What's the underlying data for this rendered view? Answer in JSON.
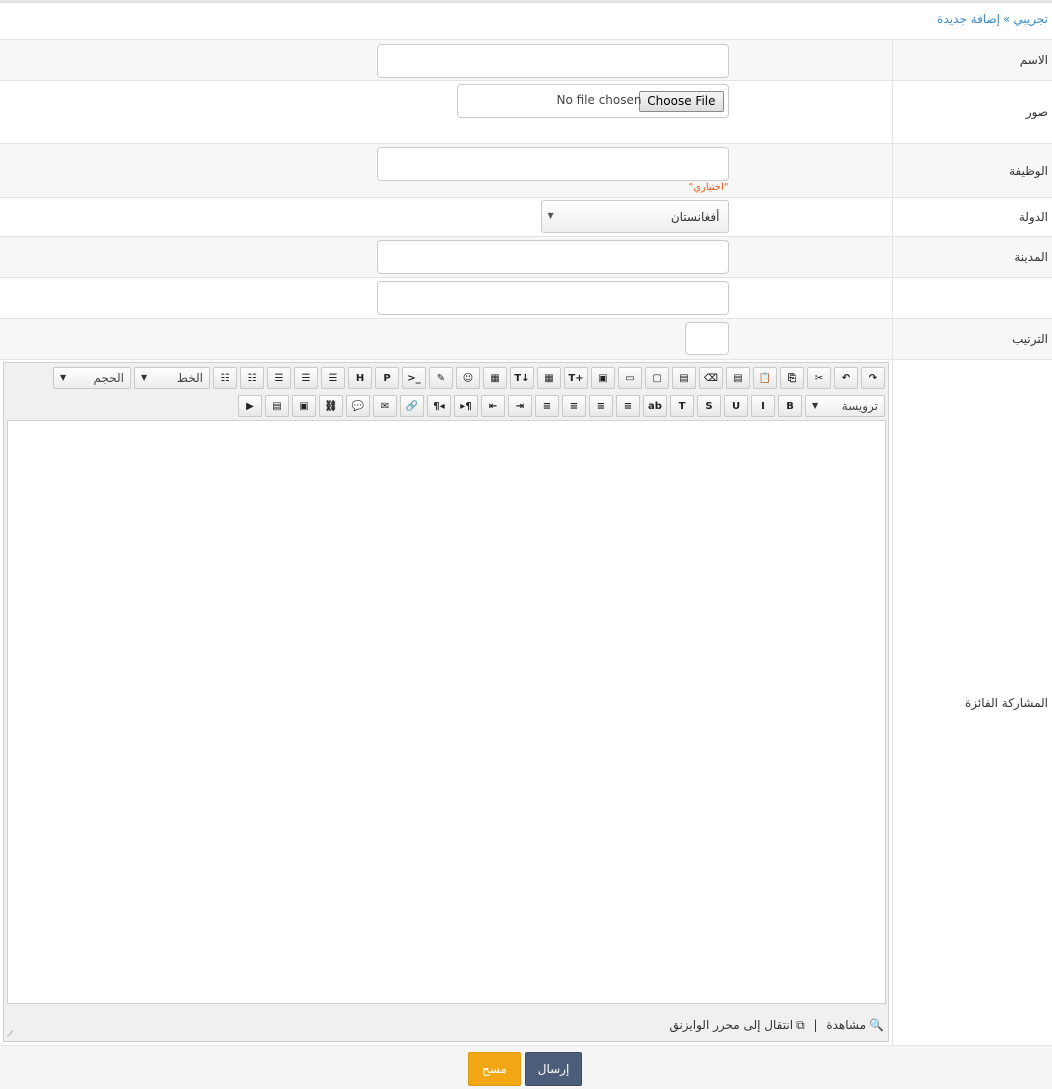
{
  "breadcrumb": {
    "parent": "تجريبي",
    "separator": "»",
    "current": "إضافة جديدة"
  },
  "form": {
    "name_label": "الاسم",
    "photos_label": "صور",
    "file_button": "Choose File",
    "file_status": "No file chosen",
    "job_label": "الوظيفة",
    "job_hint": "\"اختياري\"",
    "country_label": "الدولة",
    "country_value": "أفغانستان",
    "city_label": "المدينة",
    "extra_label": "",
    "order_label": "الترتيب",
    "entry_label": "المشاركة الفائزة"
  },
  "editor": {
    "format_select": "ترويسة",
    "font_select": "الخط",
    "size_select": "الحجم",
    "preview_label": "مشاهدة",
    "foot_sep": "|",
    "wysiwyg_label": "انتقال إلى محرر الوايزنق",
    "row1_icons": [
      "redo-icon",
      "undo-icon",
      "cut-icon",
      "copy-icon",
      "paste-icon",
      "paste-text-icon",
      "eraser-icon",
      "paste-word-icon",
      "fullscreen-icon",
      "image-icon",
      "insert-image-icon",
      "insert-text-icon",
      "insert-file-icon",
      "insert-text-below-icon",
      "insert-file-below-icon",
      "emoticon-icon",
      "edit-icon",
      "code-icon",
      "php-icon",
      "html-icon",
      "ordered-list-icon",
      "unordered-list-icon",
      "list-icon",
      "numbered-list-icon",
      "bullet-list-icon"
    ],
    "row2_icons": [
      "bold-icon",
      "italic-icon",
      "underline-icon",
      "strikethrough-icon",
      "text-color-icon",
      "highlight-icon",
      "align-right-icon",
      "align-center-icon",
      "align-left-icon",
      "align-justify-icon",
      "indent-icon",
      "outdent-icon",
      "ltr-icon",
      "rtl-icon",
      "link-icon",
      "email-icon",
      "quote-icon",
      "unlink-icon",
      "insert-photo-icon",
      "gallery-icon",
      "media-icon"
    ],
    "row1_glyphs": [
      "↷",
      "↶",
      "✂",
      "⎘",
      "📋",
      "▤",
      "⌫",
      "▤",
      "▢",
      "▭",
      "▣",
      "T+",
      "▦",
      "T↓",
      "▦",
      "☺",
      "✎",
      ">_",
      "P",
      "H",
      "☰",
      "☰",
      "☰",
      "☷",
      "☷"
    ],
    "row2_glyphs": [
      "B",
      "I",
      "U",
      "S",
      "T",
      "ab",
      "≡",
      "≡",
      "≡",
      "≡",
      "⇥",
      "⇤",
      "▸¶",
      "¶◂",
      "🔗",
      "✉",
      "💬",
      "⛓",
      "▣",
      "▤",
      "▶"
    ]
  },
  "buttons": {
    "send": "إرسال",
    "clear": "مسح"
  }
}
